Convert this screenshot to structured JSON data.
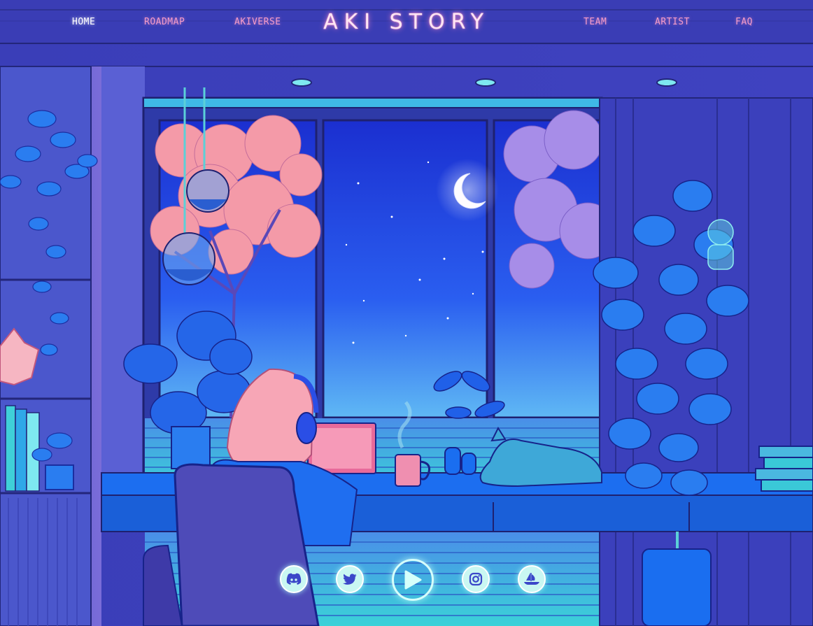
{
  "nav": {
    "left": [
      {
        "label": "HOME",
        "active": true
      },
      {
        "label": "ROADMAP",
        "active": false
      },
      {
        "label": "AKIVERSE",
        "active": false
      }
    ],
    "brand": "AKI STORY",
    "right": [
      {
        "label": "TEAM",
        "active": false
      },
      {
        "label": "ARTIST",
        "active": false
      },
      {
        "label": "FAQ",
        "active": false
      }
    ]
  },
  "social": [
    {
      "icon": "discord-icon"
    },
    {
      "icon": "twitter-icon"
    },
    {
      "icon": "play-icon"
    },
    {
      "icon": "instagram-icon"
    },
    {
      "icon": "opensea-icon"
    }
  ],
  "colors": {
    "nav_text": "#f49cc8",
    "nav_active": "#ffffff",
    "brand_glow": "#ff8cc8",
    "room_blue": "#3b3fb8",
    "window_sky": "#1a3fd6",
    "blossom_pink": "#f49aa8",
    "social_bg": "#c9f7f2"
  }
}
